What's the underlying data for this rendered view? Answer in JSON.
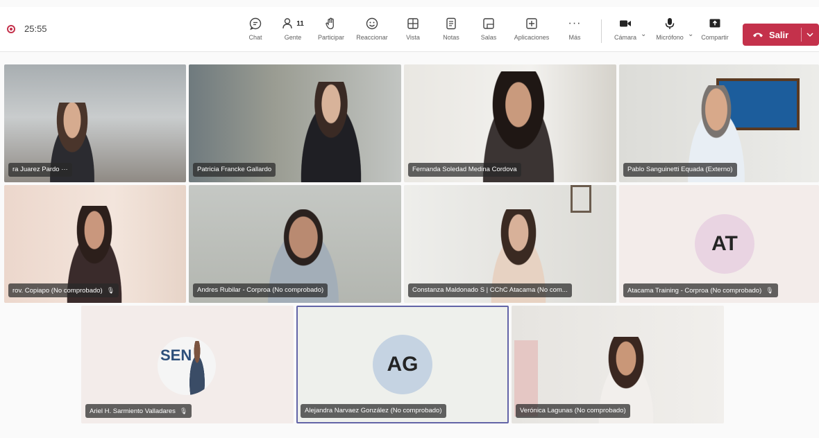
{
  "timer": "25:55",
  "toolbar": {
    "chat": "Chat",
    "people": "Gente",
    "people_count": "11",
    "raise": "Participar",
    "react": "Reaccionar",
    "view": "Vista",
    "notes": "Notas",
    "rooms": "Salas",
    "apps": "Aplicaciones",
    "more": "Más",
    "camera": "Cámara",
    "mic": "Micrófono",
    "share": "Compartir",
    "leave": "Salir"
  },
  "participants": [
    {
      "name": "ra Juarez Pardo ···"
    },
    {
      "name": "Patricia Francke Gallardo"
    },
    {
      "name": "Fernanda Soledad Medina Cordova"
    },
    {
      "name": "Pablo Sanguinetti Equada (Externo)"
    },
    {
      "name": "rov. Copiapo (No comprobado)"
    },
    {
      "name": "Andres Rubilar - Corproa (No comprobado)"
    },
    {
      "name": "Constanza Maldonado S | CChC Atacama (No com..."
    },
    {
      "name": "Atacama Training - Corproa (No comprobado)",
      "initials": "AT"
    },
    {
      "name": "Ariel H. Sarmiento Valladares"
    },
    {
      "name": "Alejandra Narvaez González (No comprobado)",
      "initials": "AG"
    },
    {
      "name": "Verónica Lagunas (No comprobado)"
    }
  ],
  "ariel_logo_text": "SEN"
}
